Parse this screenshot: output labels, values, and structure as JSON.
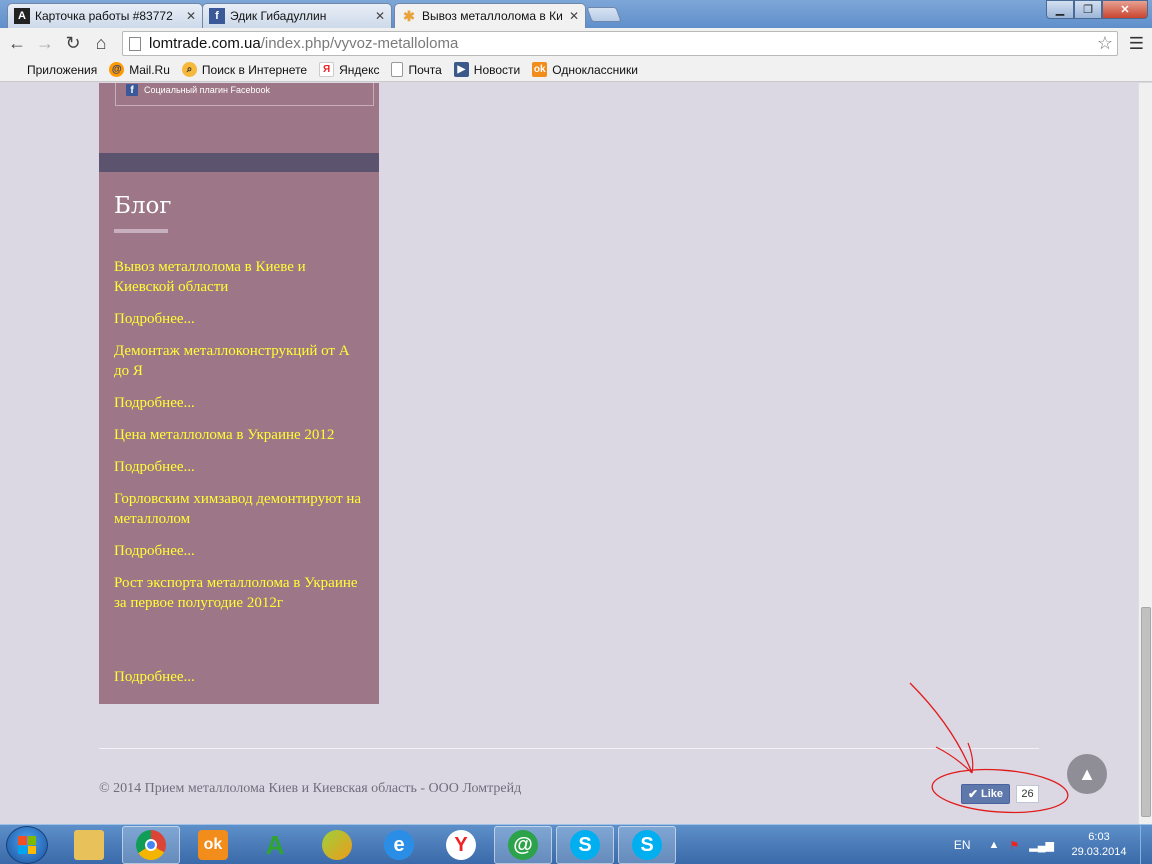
{
  "browser": {
    "tabs": [
      {
        "title": "Карточка работы #83772",
        "favicon_letter": "A",
        "favicon_color": "#222222"
      },
      {
        "title": "Эдик Гибадуллин",
        "favicon_letter": "f",
        "favicon_color": "#3b5998"
      },
      {
        "title": "Вывоз металлолома в Ки",
        "favicon_letter": "✱",
        "favicon_color": "#e8a33d"
      }
    ],
    "url_host": "lomtrade.com.ua",
    "url_path": "/index.php/vyvoz-metalloloma",
    "bookmarks": [
      {
        "label": "Приложения",
        "icon": "apps-grid-icon"
      },
      {
        "label": "Mail.Ru",
        "icon": "mailru-icon"
      },
      {
        "label": "Поиск в Интернете",
        "icon": "search-icon"
      },
      {
        "label": "Яндекс",
        "icon": "yandex-icon"
      },
      {
        "label": "Почта",
        "icon": "page-icon"
      },
      {
        "label": "Новости",
        "icon": "news-icon"
      },
      {
        "label": "Одноклассники",
        "icon": "odnoklassniki-icon"
      }
    ]
  },
  "page": {
    "facebook_plugin": "Социальный плагин Facebook",
    "blog_title": "Блог",
    "blog_links": [
      "Вывоз металлолома в Киеве и Киевской области",
      "Подробнее...",
      "Демонтаж металлоконструкций от А до Я",
      "Подробнее...",
      "Цена металлолома в Украине 2012",
      "Подробнее...",
      "Горловским химзавод демонтируют на металлолом",
      "Подробнее...",
      "Рост экспорта металлолома в Украине за первое полугодие 2012г",
      "Подробнее..."
    ],
    "copyright": "© 2014 Прием металлолома Киев и Киевская область - ООО Ломтрейд",
    "like_label": "Like",
    "like_count": "26"
  },
  "taskbar": {
    "language": "EN",
    "time": "6:03",
    "date": "29.03.2014"
  },
  "colors": {
    "sidebar": "#9d7787",
    "link": "#ffff33",
    "page_bg": "#dcd8e3"
  }
}
